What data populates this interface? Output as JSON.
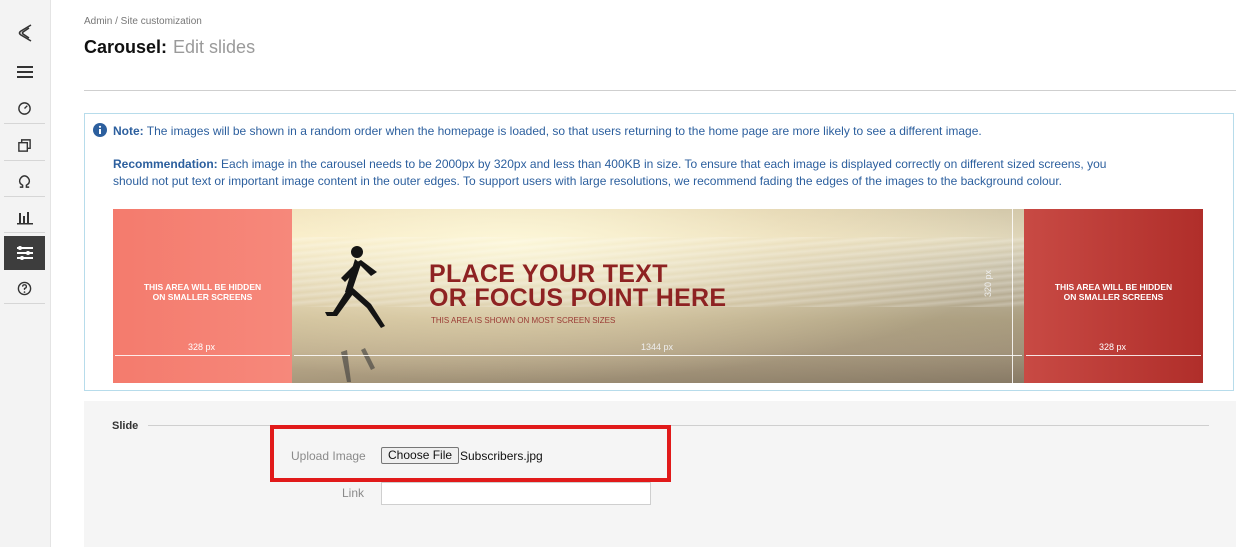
{
  "breadcrumb": "Admin / Site customization",
  "page": {
    "title": "Carousel:",
    "subtitle": "Edit slides"
  },
  "note": {
    "label": "Note:",
    "text": " The images will be shown in a random order when the homepage is loaded, so that users returning to the home page are more likely to see a different image."
  },
  "recommendation": {
    "label": "Recommendation:",
    "text": " Each image in the carousel needs to be 2000px by 320px and less than 400KB in size. To ensure that each image is displayed correctly on different sized screens, you should not put text or important image content in the outer edges. To support users with large resolutions, we recommend fading the edges of the images to the background colour."
  },
  "banner": {
    "hidden_left_1": "THIS AREA WILL BE HIDDEN",
    "hidden_left_2": "ON SMALLER SCREENS",
    "hidden_right_1": "THIS AREA WILL BE HIDDEN",
    "hidden_right_2": "ON SMALLER SCREENS",
    "headline_1": "PLACE YOUR TEXT",
    "headline_2": "OR FOCUS POINT HERE",
    "subline": "THIS AREA IS SHOWN ON MOST SCREEN SIZES",
    "left_width": "328 px",
    "middle_width": "1344 px",
    "right_width": "328 px",
    "height": "320 px"
  },
  "form": {
    "legend": "Slide",
    "upload_label": "Upload Image",
    "choose_label": "Choose File",
    "file_name": "Subscribers.jpg",
    "link_label": "Link",
    "link_value": ""
  },
  "colors": {
    "accent_highlight": "#e11a1a",
    "info_text": "#2c5f9e",
    "active_rail": "#3d3d3d"
  }
}
